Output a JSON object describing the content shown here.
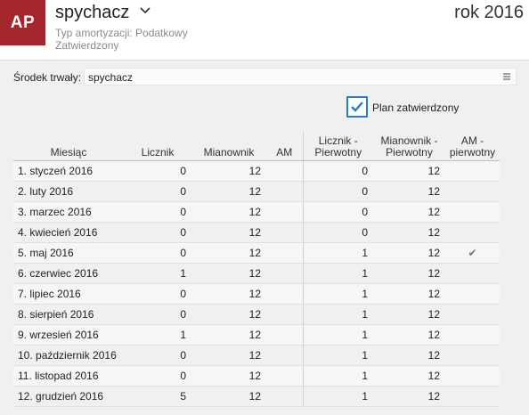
{
  "header": {
    "avatar_text": "AP",
    "title": "spychacz",
    "subtitle_line1": "Typ amortyzacji: Podatkowy",
    "subtitle_line2": "Zatwierdzony",
    "year": "rok 2016"
  },
  "asset_field": {
    "label": "Środek trwały:",
    "value": "spychacz"
  },
  "plan_checkbox": {
    "label": "Plan zatwierdzony",
    "checked": true
  },
  "table": {
    "columns": {
      "month": "Miesiąc",
      "counter": "Licznik",
      "denominator": "Mianownik",
      "am": "AM",
      "counter_orig": [
        "Licznik -",
        "Pierwotny"
      ],
      "denominator_orig": [
        "Mianownik -",
        "Pierwotny"
      ],
      "am_orig": [
        "AM -",
        "pierwotny"
      ]
    },
    "rows": [
      {
        "month": "1. styczeń 2016",
        "counter": "0",
        "denominator": "12",
        "am": "",
        "counter_orig": "0",
        "denominator_orig": "12",
        "am_orig": ""
      },
      {
        "month": "2. luty 2016",
        "counter": "0",
        "denominator": "12",
        "am": "",
        "counter_orig": "0",
        "denominator_orig": "12",
        "am_orig": ""
      },
      {
        "month": "3. marzec 2016",
        "counter": "0",
        "denominator": "12",
        "am": "",
        "counter_orig": "0",
        "denominator_orig": "12",
        "am_orig": ""
      },
      {
        "month": "4. kwiecień 2016",
        "counter": "0",
        "denominator": "12",
        "am": "",
        "counter_orig": "0",
        "denominator_orig": "12",
        "am_orig": ""
      },
      {
        "month": "5. maj 2016",
        "counter": "0",
        "denominator": "12",
        "am": "",
        "counter_orig": "1",
        "denominator_orig": "12",
        "am_orig": "✔"
      },
      {
        "month": "6. czerwiec 2016",
        "counter": "1",
        "denominator": "12",
        "am": "",
        "counter_orig": "1",
        "denominator_orig": "12",
        "am_orig": ""
      },
      {
        "month": "7. lipiec 2016",
        "counter": "0",
        "denominator": "12",
        "am": "",
        "counter_orig": "1",
        "denominator_orig": "12",
        "am_orig": ""
      },
      {
        "month": "8. sierpień 2016",
        "counter": "0",
        "denominator": "12",
        "am": "",
        "counter_orig": "1",
        "denominator_orig": "12",
        "am_orig": ""
      },
      {
        "month": "9. wrzesień 2016",
        "counter": "1",
        "denominator": "12",
        "am": "",
        "counter_orig": "1",
        "denominator_orig": "12",
        "am_orig": ""
      },
      {
        "month": "10. październik 2016",
        "counter": "0",
        "denominator": "12",
        "am": "",
        "counter_orig": "1",
        "denominator_orig": "12",
        "am_orig": ""
      },
      {
        "month": "11. listopad 2016",
        "counter": "0",
        "denominator": "12",
        "am": "",
        "counter_orig": "1",
        "denominator_orig": "12",
        "am_orig": ""
      },
      {
        "month": "12. grudzień 2016",
        "counter": "5",
        "denominator": "12",
        "am": "",
        "counter_orig": "1",
        "denominator_orig": "12",
        "am_orig": ""
      }
    ]
  }
}
